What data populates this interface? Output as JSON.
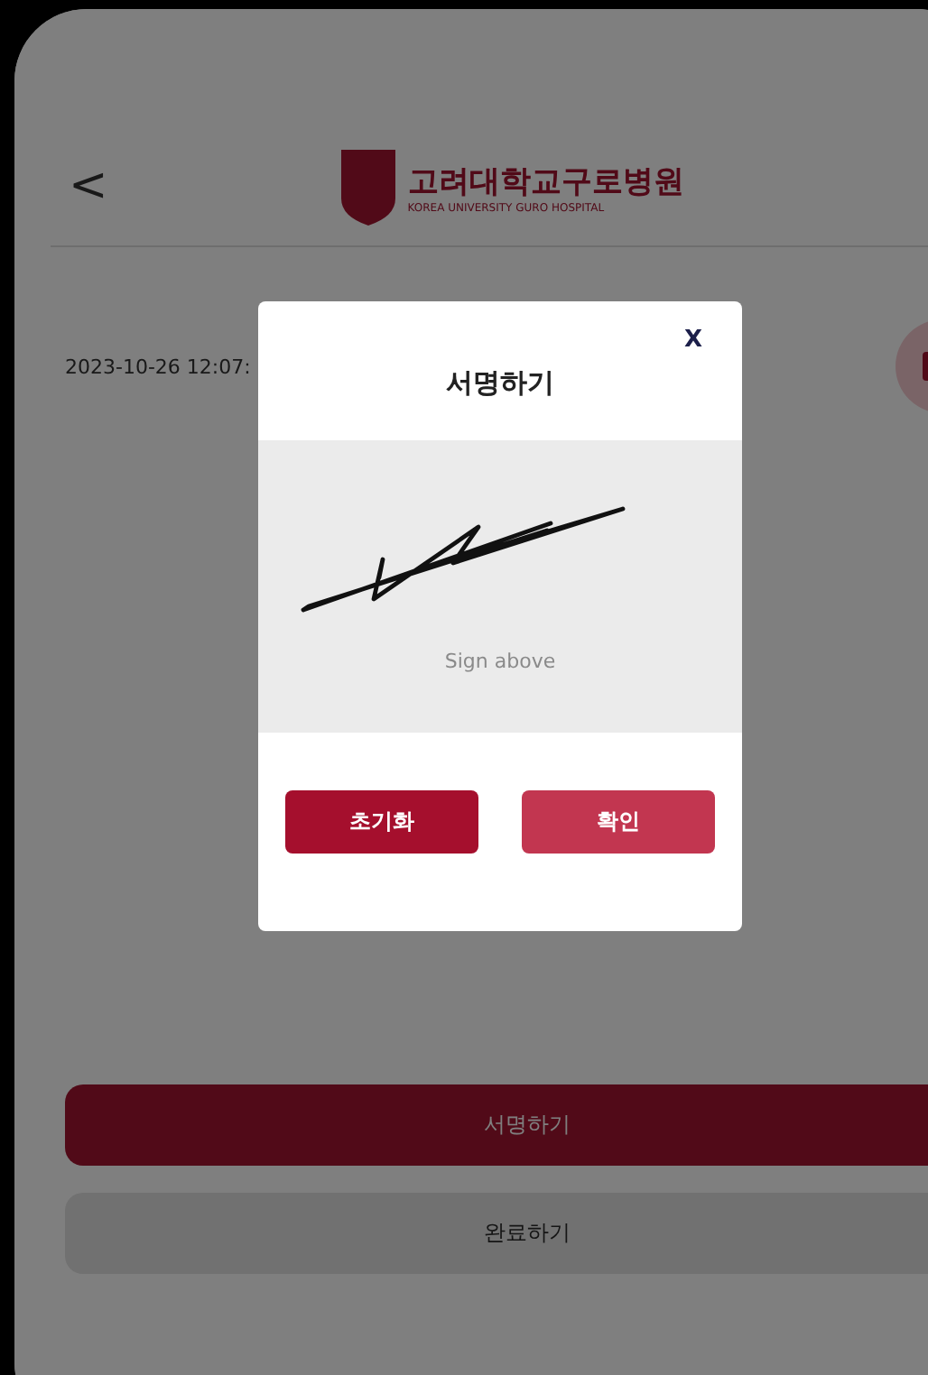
{
  "header": {
    "back": "<",
    "hospital_name": "고려대학교구로병원",
    "hospital_subtitle": "KOREA UNIVERSITY GURO HOSPITAL"
  },
  "document": {
    "date": "2023-10-26 12:07:"
  },
  "actions": [
    {
      "label": "서명하기",
      "disabled": false
    },
    {
      "label": "완료하기",
      "disabled": true
    }
  ],
  "dialog": {
    "title": "서명하기",
    "close": "X",
    "pad_hint": "Sign above",
    "buttons": [
      {
        "label": "초기화",
        "kind": "reset"
      },
      {
        "label": "확인",
        "kind": "confirm"
      }
    ]
  }
}
